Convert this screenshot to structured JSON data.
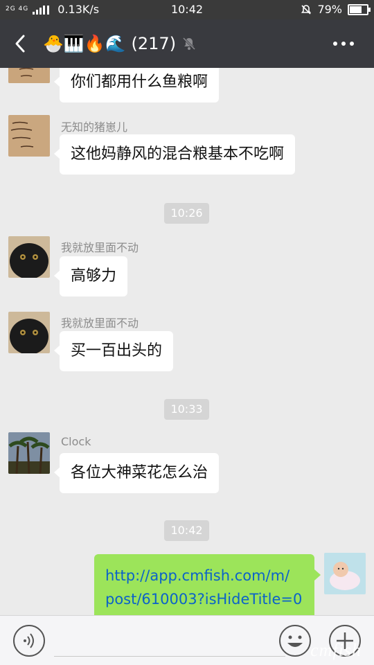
{
  "status_bar": {
    "signal_label": "2G 4G",
    "net_speed": "0.13K/s",
    "time": "10:42",
    "battery": "79%",
    "battery_level": 0.79
  },
  "header": {
    "title_emoji": "🐣🎹🔥🌊",
    "member_count": "(217)"
  },
  "messages": [
    {
      "sender": "",
      "text": "你们都用什么鱼粮啊"
    },
    {
      "sender": "无知的猪崽儿",
      "text": "这他妈静风的混合粮基本不吃啊"
    },
    {
      "time": "10:26"
    },
    {
      "sender": "我就放里面不动",
      "text": "高够力"
    },
    {
      "sender": "我就放里面不动",
      "text": "买一百出头的"
    },
    {
      "time": "10:33"
    },
    {
      "sender": "Clock",
      "text": "各位大神菜花怎么治"
    },
    {
      "time": "10:42"
    },
    {
      "self": true,
      "lines": [
        "http://app.cmfish.com/m/",
        "post/610003?isHideTitle=0"
      ]
    }
  ],
  "watermark": "cmfish",
  "colors": {
    "titlebar": "#393a3f",
    "chat_bg": "#ebebeb",
    "self_bubble": "#9ce45a",
    "link": "#0b62c9"
  },
  "icons": {
    "back": "chevron-left-icon",
    "mute": "bell-off-icon",
    "more": "more-dots-icon",
    "voice": "voice-icon",
    "emoji": "emoji-icon",
    "add": "plus-circle-icon"
  }
}
